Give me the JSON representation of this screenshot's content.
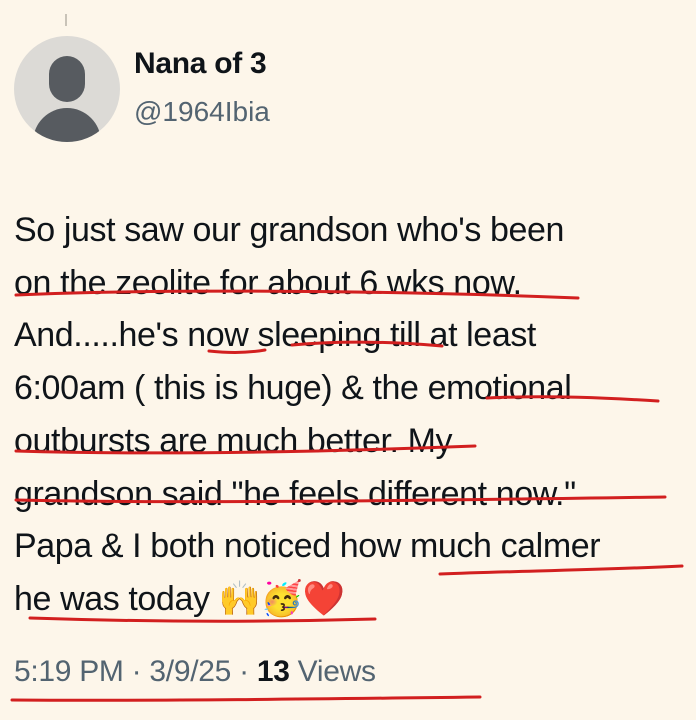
{
  "author": {
    "display_name": "Nana of 3",
    "handle": "@1964Ibia"
  },
  "tweet": {
    "lines": [
      "So just saw our grandson who's been",
      "on the zeolite for about 6 wks now.",
      "And.....he's now sleeping till at least",
      "6:00am ( this is huge) & the emotional",
      "outbursts are much better. My",
      "grandson said \"he feels different now.\"",
      "Papa & I both noticed how much calmer",
      "he was today"
    ],
    "emojis": [
      "raising-hands",
      "partying-face",
      "red-heart"
    ],
    "emoji_chars": "🙌🥳❤️"
  },
  "meta": {
    "time": "5:19 PM",
    "separator": "·",
    "date": "3/9/25",
    "views_count": "13",
    "views_label": "Views"
  },
  "annotation_color": "#d21f1f"
}
